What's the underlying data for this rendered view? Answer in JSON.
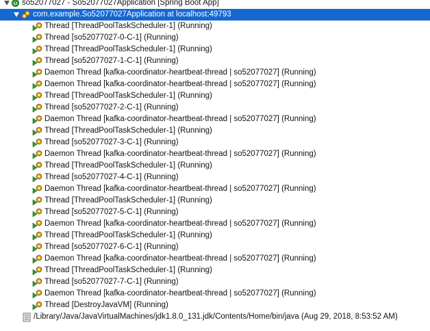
{
  "app": {
    "label": "so52077027 - So52077027Application [Spring Boot App]",
    "icon": "spring-boot-app-icon"
  },
  "vm": {
    "label": "com.example.So52077027Application at localhost:49793",
    "icon": "debug-target-icon"
  },
  "threads": [
    "Thread [ThreadPoolTaskScheduler-1] (Running)",
    "Thread [so52077027-0-C-1] (Running)",
    "Thread [ThreadPoolTaskScheduler-1] (Running)",
    "Thread [so52077027-1-C-1] (Running)",
    "Daemon Thread [kafka-coordinator-heartbeat-thread | so52077027] (Running)",
    "Daemon Thread [kafka-coordinator-heartbeat-thread | so52077027] (Running)",
    "Thread [ThreadPoolTaskScheduler-1] (Running)",
    "Thread [so52077027-2-C-1] (Running)",
    "Daemon Thread [kafka-coordinator-heartbeat-thread | so52077027] (Running)",
    "Thread [ThreadPoolTaskScheduler-1] (Running)",
    "Thread [so52077027-3-C-1] (Running)",
    "Daemon Thread [kafka-coordinator-heartbeat-thread | so52077027] (Running)",
    "Thread [ThreadPoolTaskScheduler-1] (Running)",
    "Thread [so52077027-4-C-1] (Running)",
    "Daemon Thread [kafka-coordinator-heartbeat-thread | so52077027] (Running)",
    "Thread [ThreadPoolTaskScheduler-1] (Running)",
    "Thread [so52077027-5-C-1] (Running)",
    "Daemon Thread [kafka-coordinator-heartbeat-thread | so52077027] (Running)",
    "Thread [ThreadPoolTaskScheduler-1] (Running)",
    "Thread [so52077027-6-C-1] (Running)",
    "Daemon Thread [kafka-coordinator-heartbeat-thread | so52077027] (Running)",
    "Thread [ThreadPoolTaskScheduler-1] (Running)",
    "Thread [so52077027-7-C-1] (Running)",
    "Daemon Thread [kafka-coordinator-heartbeat-thread | so52077027] (Running)",
    "Thread [DestroyJavaVM] (Running)"
  ],
  "thread_icon": "running-thread-icon",
  "process": {
    "label": "/Library/Java/JavaVirtualMachines/jdk1.8.0_131.jdk/Contents/Home/bin/java (Aug 29, 2018, 8:53:52 AM)",
    "icon": "java-process-icon"
  },
  "colors": {
    "selection": "#1568d2",
    "running_green": "#2e9b2e",
    "gear_yellow": "#d9a21b"
  }
}
